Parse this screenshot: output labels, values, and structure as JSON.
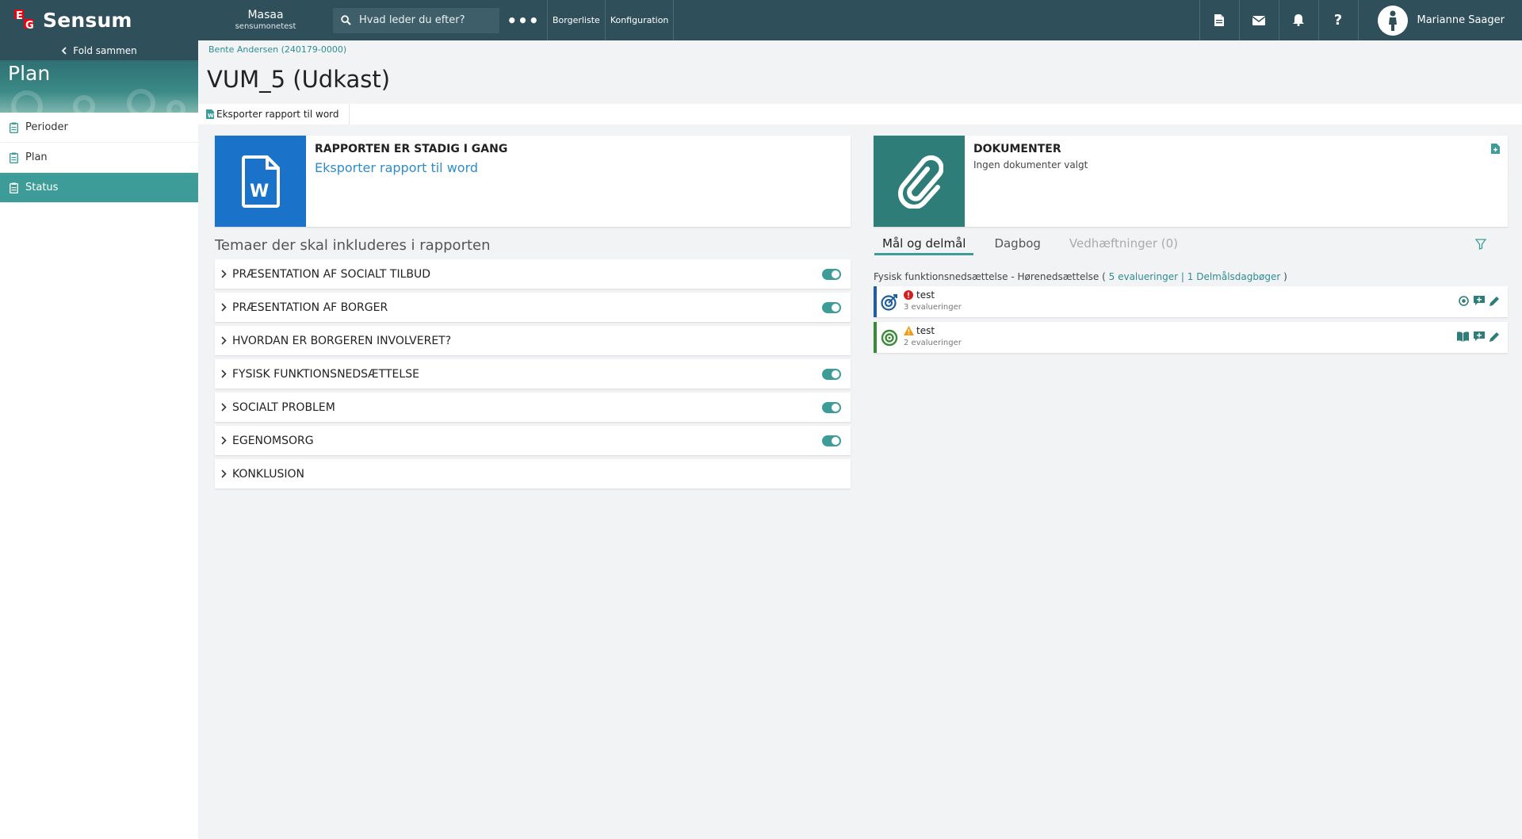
{
  "header": {
    "logo_letters": [
      "E",
      "G"
    ],
    "app_name": "Sensum",
    "org_name": "Masaa",
    "org_sub": "sensumonetest",
    "search_placeholder": "Hvad leder du efter?",
    "more_label": "•••",
    "links": [
      "Borgerliste",
      "Konfiguration"
    ],
    "user_name": "Marianne Saager",
    "icons": [
      "document-icon",
      "mail-icon",
      "bell-icon",
      "help-icon"
    ]
  },
  "sidebar": {
    "fold_label": "Fold sammen",
    "section_title": "Plan",
    "items": [
      {
        "label": "Perioder",
        "active": false
      },
      {
        "label": "Plan",
        "active": false
      },
      {
        "label": "Status",
        "active": true
      }
    ]
  },
  "main": {
    "breadcrumb": "Bente Andersen (240179-0000)",
    "title": "VUM_5 (Udkast)",
    "export_label": "Eksporter rapport til word",
    "report_card": {
      "title": "RAPPORTEN ER STADIG I GANG",
      "link": "Eksporter rapport til word",
      "tile_color": "#1a73c9"
    },
    "documents_card": {
      "title": "DOKUMENTER",
      "subtitle": "Ingen dokumenter valgt",
      "tile_color": "#2f7d79"
    },
    "themes_title": "Temaer der skal inkluderes i rapporten",
    "themes": [
      {
        "label": "PRÆSENTATION AF SOCIALT TILBUD",
        "toggle": true
      },
      {
        "label": "PRÆSENTATION AF BORGER",
        "toggle": true
      },
      {
        "label": "HVORDAN ER BORGEREN INVOLVERET?",
        "toggle": false
      },
      {
        "label": "FYSISK FUNKTIONSNEDSÆTTELSE",
        "toggle": true
      },
      {
        "label": "SOCIALT PROBLEM",
        "toggle": true
      },
      {
        "label": "EGENOMSORG",
        "toggle": true
      },
      {
        "label": "KONKLUSION",
        "toggle": false
      }
    ],
    "tabs": [
      {
        "label": "Mål og delmål",
        "state": "active"
      },
      {
        "label": "Dagbog",
        "state": "normal"
      },
      {
        "label": "Vedhæftninger (0)",
        "state": "disabled"
      }
    ],
    "goals_header": {
      "text": "Fysisk funktionsnedsættelse - Hørenedsættelse (",
      "link1": "5 evalueringer",
      "sep": "|",
      "link2": "1 Delmålsdagbøger",
      "close": ")"
    },
    "goals": [
      {
        "name": "test",
        "sub": "3 evalueringer",
        "bar_color": "#1f5f9f",
        "badge": "error"
      },
      {
        "name": "test",
        "sub": "2 evalueringer",
        "bar_color": "#3a8a3a",
        "badge": "warning"
      }
    ]
  },
  "colors": {
    "topbar": "#2f4f5a",
    "accent": "#3e9c98",
    "link": "#2e8cc9"
  }
}
